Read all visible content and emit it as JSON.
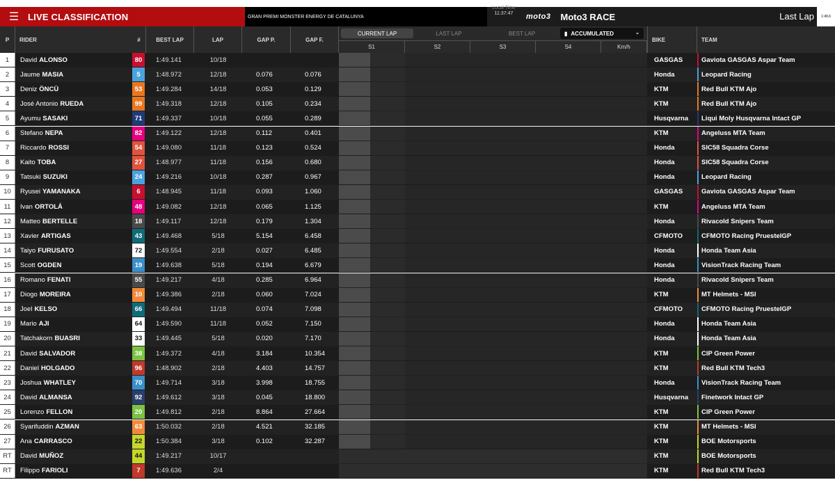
{
  "header": {
    "menu_icon": "hamburger-menu-icon",
    "title": "LIVE CLASSIFICATION",
    "event": "GRAN PREMI MONSTER ENERGY DE CATALUNYA",
    "local_time_label": "Local Time",
    "local_time": "11:37:47",
    "brand": "moto3",
    "race": "Moto3 RACE",
    "last_lap_label": "Last Lap",
    "last_lap_value": "1:49.6"
  },
  "columns": {
    "p": "P",
    "rider": "RIDER",
    "num": "#",
    "best_lap": "BEST LAP",
    "lap": "LAP",
    "gap_p": "GAP P.",
    "gap_f": "GAP F.",
    "tabs": [
      "CURRENT LAP",
      "LAST LAP",
      "BEST LAP"
    ],
    "accumulated": "ACCUMULATED",
    "sectors": [
      "S1",
      "S2",
      "S3",
      "S4",
      "Km/h"
    ],
    "bike": "BIKE",
    "team": "TEAM"
  },
  "colors": {
    "accent_red": "#b30d10",
    "header_bg": "#2a2a2a",
    "row_bg": "#1e1e1e"
  },
  "rows": [
    {
      "p": "1",
      "first": "David",
      "last": "ALONSO",
      "num": "80",
      "num_color": "#c8102e",
      "best": "1:49.141",
      "lap": "10/18",
      "gapp": "",
      "gapf": "",
      "bike": "GASGAS",
      "team": "Gaviota GASGAS Aspar Team",
      "team_color": "#c8102e"
    },
    {
      "p": "2",
      "first": "Jaume",
      "last": "MASIA",
      "num": "5",
      "num_color": "#4aa3df",
      "best": "1:48.972",
      "lap": "12/18",
      "gapp": "0.076",
      "gapf": "0.076",
      "bike": "Honda",
      "team": "Leopard Racing",
      "team_color": "#4aa3df"
    },
    {
      "p": "3",
      "first": "Deniz",
      "last": "ÖNCÜ",
      "num": "53",
      "num_color": "#e87722",
      "best": "1:49.284",
      "lap": "14/18",
      "gapp": "0.053",
      "gapf": "0.129",
      "bike": "KTM",
      "team": "Red Bull KTM Ajo",
      "team_color": "#e87722"
    },
    {
      "p": "4",
      "first": "José Antonio",
      "last": "RUEDA",
      "num": "99",
      "num_color": "#e87722",
      "best": "1:49.318",
      "lap": "12/18",
      "gapp": "0.105",
      "gapf": "0.234",
      "bike": "KTM",
      "team": "Red Bull KTM Ajo",
      "team_color": "#e87722"
    },
    {
      "p": "5",
      "first": "Ayumu",
      "last": "SASAKI",
      "num": "71",
      "num_color": "#1e3a78",
      "best": "1:49.337",
      "lap": "10/18",
      "gapp": "0.055",
      "gapf": "0.289",
      "bike": "Husqvarna",
      "team": "Liqui Moly Husqvarna Intact GP",
      "team_color": "#1e3a78"
    },
    {
      "p": "6",
      "first": "Stefano",
      "last": "NEPA",
      "num": "82",
      "num_color": "#e6007e",
      "best": "1:49.122",
      "lap": "12/18",
      "gapp": "0.112",
      "gapf": "0.401",
      "bike": "KTM",
      "team": "Angeluss MTA Team",
      "team_color": "#e6007e"
    },
    {
      "p": "7",
      "first": "Riccardo",
      "last": "ROSSI",
      "num": "54",
      "num_color": "#e0533d",
      "best": "1:49.080",
      "lap": "11/18",
      "gapp": "0.123",
      "gapf": "0.524",
      "bike": "Honda",
      "team": "SIC58 Squadra Corse",
      "team_color": "#e0533d"
    },
    {
      "p": "8",
      "first": "Kaito",
      "last": "TOBA",
      "num": "27",
      "num_color": "#e0533d",
      "best": "1:48.977",
      "lap": "11/18",
      "gapp": "0.156",
      "gapf": "0.680",
      "bike": "Honda",
      "team": "SIC58 Squadra Corse",
      "team_color": "#e0533d"
    },
    {
      "p": "9",
      "first": "Tatsuki",
      "last": "SUZUKI",
      "num": "24",
      "num_color": "#4aa3df",
      "best": "1:49.216",
      "lap": "10/18",
      "gapp": "0.287",
      "gapf": "0.967",
      "bike": "Honda",
      "team": "Leopard Racing",
      "team_color": "#4aa3df"
    },
    {
      "p": "10",
      "first": "Ryusei",
      "last": "YAMANAKA",
      "num": "6",
      "num_color": "#c8102e",
      "best": "1:48.945",
      "lap": "11/18",
      "gapp": "0.093",
      "gapf": "1.060",
      "bike": "GASGAS",
      "team": "Gaviota GASGAS Aspar Team",
      "team_color": "#c8102e"
    },
    {
      "p": "11",
      "first": "Ivan",
      "last": "ORTOLÁ",
      "num": "48",
      "num_color": "#e6007e",
      "best": "1:49.082",
      "lap": "12/18",
      "gapp": "0.065",
      "gapf": "1.125",
      "bike": "KTM",
      "team": "Angeluss MTA Team",
      "team_color": "#e6007e"
    },
    {
      "p": "12",
      "first": "Matteo",
      "last": "BERTELLE",
      "num": "18",
      "num_color": "#4a4a4a",
      "best": "1:49.117",
      "lap": "12/18",
      "gapp": "0.179",
      "gapf": "1.304",
      "bike": "Honda",
      "team": "Rivacold Snipers Team",
      "team_color": "#4a4a4a"
    },
    {
      "p": "13",
      "first": "Xavier",
      "last": "ARTIGAS",
      "num": "43",
      "num_color": "#0f6b7a",
      "best": "1:49.468",
      "lap": "5/18",
      "gapp": "5.154",
      "gapf": "6.458",
      "bike": "CFMOTO",
      "team": "CFMOTO Racing PruestelGP",
      "team_color": "#0f6b7a"
    },
    {
      "p": "14",
      "first": "Taiyo",
      "last": "FURUSATO",
      "num": "72",
      "num_color": "#ffffff",
      "best": "1:49.554",
      "lap": "2/18",
      "gapp": "0.027",
      "gapf": "6.485",
      "bike": "Honda",
      "team": "Honda Team Asia",
      "team_color": "#ffffff"
    },
    {
      "p": "15",
      "first": "Scott",
      "last": "OGDEN",
      "num": "19",
      "num_color": "#3a8fc9",
      "best": "1:49.638",
      "lap": "5/18",
      "gapp": "0.194",
      "gapf": "6.679",
      "bike": "Honda",
      "team": "VisionTrack Racing Team",
      "team_color": "#3a8fc9"
    },
    {
      "p": "16",
      "first": "Romano",
      "last": "FENATI",
      "num": "55",
      "num_color": "#4a4a4a",
      "best": "1:49.217",
      "lap": "4/18",
      "gapp": "0.285",
      "gapf": "6.964",
      "bike": "Honda",
      "team": "Rivacold Snipers Team",
      "team_color": "#4a4a4a"
    },
    {
      "p": "17",
      "first": "Diogo",
      "last": "MOREIRA",
      "num": "10",
      "num_color": "#f08a3a",
      "best": "1:49.386",
      "lap": "2/18",
      "gapp": "0.060",
      "gapf": "7.024",
      "bike": "KTM",
      "team": "MT Helmets - MSI",
      "team_color": "#f08a3a"
    },
    {
      "p": "18",
      "first": "Joel",
      "last": "KELSO",
      "num": "66",
      "num_color": "#0f6b7a",
      "best": "1:49.494",
      "lap": "11/18",
      "gapp": "0.074",
      "gapf": "7.098",
      "bike": "CFMOTO",
      "team": "CFMOTO Racing PruestelGP",
      "team_color": "#0f6b7a"
    },
    {
      "p": "19",
      "first": "Mario",
      "last": "AJI",
      "num": "64",
      "num_color": "#ffffff",
      "best": "1:49.590",
      "lap": "11/18",
      "gapp": "0.052",
      "gapf": "7.150",
      "bike": "Honda",
      "team": "Honda Team Asia",
      "team_color": "#ffffff"
    },
    {
      "p": "20",
      "first": "Tatchakorn",
      "last": "BUASRI",
      "num": "33",
      "num_color": "#ffffff",
      "best": "1:49.445",
      "lap": "5/18",
      "gapp": "0.020",
      "gapf": "7.170",
      "bike": "Honda",
      "team": "Honda Team Asia",
      "team_color": "#ffffff"
    },
    {
      "p": "21",
      "first": "David",
      "last": "SALVADOR",
      "num": "38",
      "num_color": "#7cc242",
      "best": "1:49.372",
      "lap": "4/18",
      "gapp": "3.184",
      "gapf": "10.354",
      "bike": "KTM",
      "team": "CIP Green Power",
      "team_color": "#7cc242"
    },
    {
      "p": "22",
      "first": "Daniel",
      "last": "HOLGADO",
      "num": "96",
      "num_color": "#c0392b",
      "best": "1:48.902",
      "lap": "2/18",
      "gapp": "4.403",
      "gapf": "14.757",
      "bike": "KTM",
      "team": "Red Bull KTM Tech3",
      "team_color": "#c0392b"
    },
    {
      "p": "23",
      "first": "Joshua",
      "last": "WHATLEY",
      "num": "70",
      "num_color": "#3a8fc9",
      "best": "1:49.714",
      "lap": "3/18",
      "gapp": "3.998",
      "gapf": "18.755",
      "bike": "Honda",
      "team": "VisionTrack Racing Team",
      "team_color": "#3a8fc9"
    },
    {
      "p": "24",
      "first": "David",
      "last": "ALMANSA",
      "num": "92",
      "num_color": "#2a3f6b",
      "best": "1:49.612",
      "lap": "3/18",
      "gapp": "0.045",
      "gapf": "18.800",
      "bike": "Husqvarna",
      "team": "Finetwork Intact GP",
      "team_color": "#2a3f6b"
    },
    {
      "p": "25",
      "first": "Lorenzo",
      "last": "FELLON",
      "num": "20",
      "num_color": "#7cc242",
      "best": "1:49.812",
      "lap": "2/18",
      "gapp": "8.864",
      "gapf": "27.664",
      "bike": "KTM",
      "team": "CIP Green Power",
      "team_color": "#7cc242"
    },
    {
      "p": "26",
      "first": "Syarifuddin",
      "last": "AZMAN",
      "num": "63",
      "num_color": "#f08a3a",
      "best": "1:50.032",
      "lap": "2/18",
      "gapp": "4.521",
      "gapf": "32.185",
      "bike": "KTM",
      "team": "MT Helmets - MSI",
      "team_color": "#f08a3a"
    },
    {
      "p": "27",
      "first": "Ana",
      "last": "CARRASCO",
      "num": "22",
      "num_color": "#c5d62c",
      "best": "1:50.384",
      "lap": "3/18",
      "gapp": "0.102",
      "gapf": "32.287",
      "bike": "KTM",
      "team": "BOE Motorsports",
      "team_color": "#c5d62c"
    },
    {
      "p": "RT",
      "first": "David",
      "last": "MUÑOZ",
      "num": "44",
      "num_color": "#c5d62c",
      "best": "1:49.217",
      "lap": "10/17",
      "gapp": "",
      "gapf": "",
      "bike": "KTM",
      "team": "BOE Motorsports",
      "team_color": "#c5d62c"
    },
    {
      "p": "RT",
      "first": "Filippo",
      "last": "FARIOLI",
      "num": "7",
      "num_color": "#c0392b",
      "best": "1:49.636",
      "lap": "2/4",
      "gapp": "",
      "gapf": "",
      "bike": "KTM",
      "team": "Red Bull KTM Tech3",
      "team_color": "#c0392b"
    }
  ]
}
